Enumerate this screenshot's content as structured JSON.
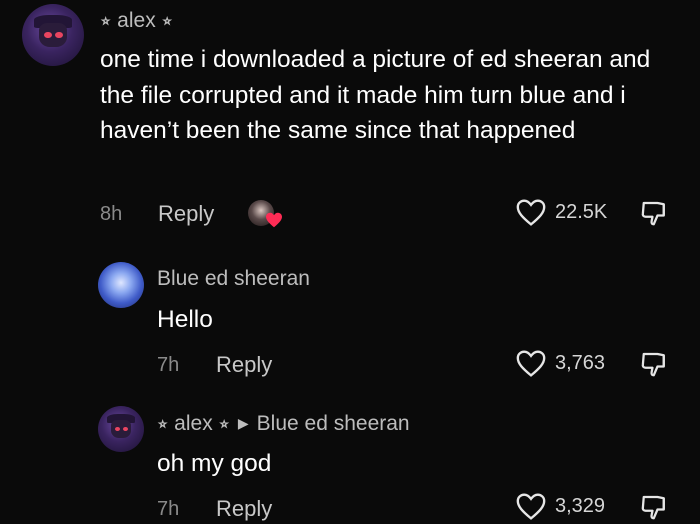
{
  "comments": [
    {
      "username": "⭒ alex ⭒",
      "text": "one time i downloaded a picture of ed sheeran and the file corrupted and it made him turn blue and i haven’t been the same since that happened",
      "time": "8h",
      "reply_label": "Reply",
      "likes": "22.5K"
    },
    {
      "username": "Blue ed sheeran",
      "text": "Hello",
      "time": "7h",
      "reply_label": "Reply",
      "likes": "3,763"
    },
    {
      "username": "⭒ alex ⭒",
      "reply_to": "Blue ed sheeran",
      "text": "oh my god",
      "time": "7h",
      "reply_label": "Reply",
      "likes": "3,329"
    }
  ],
  "icons": {
    "like": "heart-outline-icon",
    "dislike": "thumbs-down-icon",
    "creator_liked": "creator-liked-badge",
    "reply_arrow": "triangle-right-icon"
  },
  "colors": {
    "background": "#0a0a0a",
    "creator_heart": "#fe2c55"
  }
}
